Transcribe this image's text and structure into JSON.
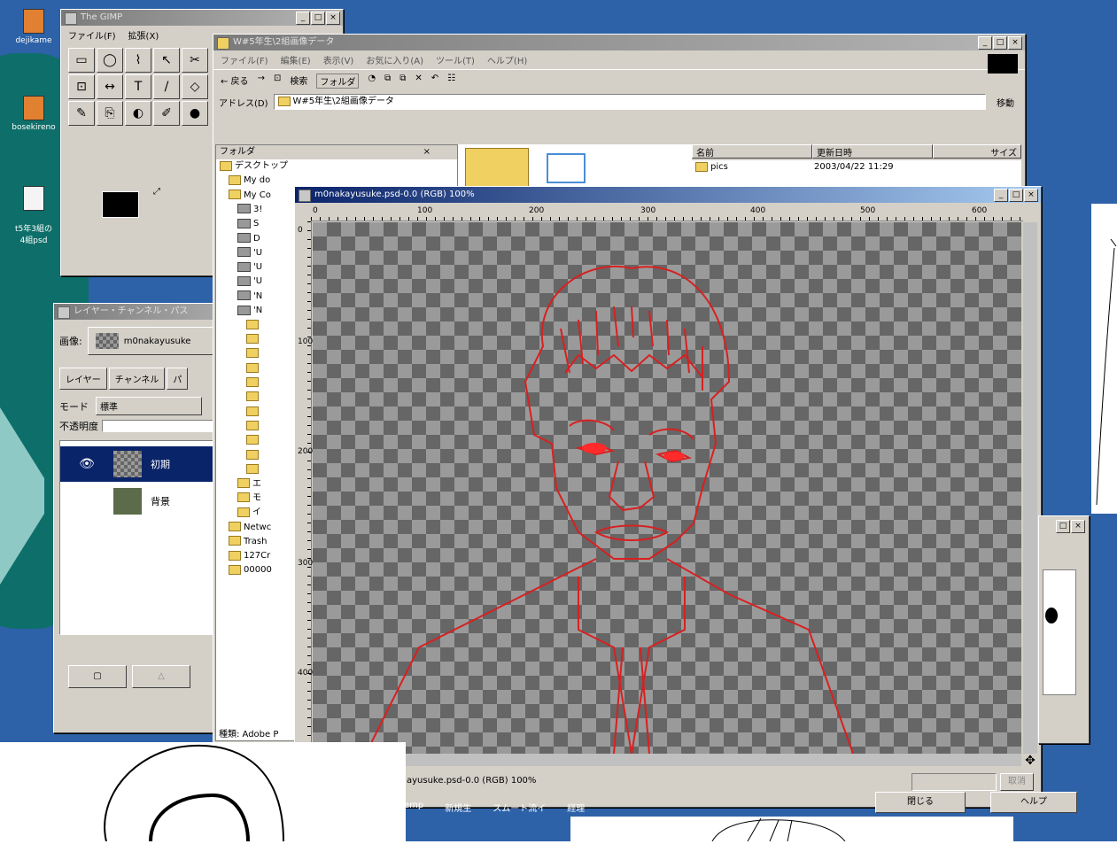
{
  "desktop": {
    "icons": [
      {
        "label": "dejikame"
      },
      {
        "label": "bosekireno"
      },
      {
        "label": "t5年3組の\n4組psd"
      }
    ]
  },
  "toolbox": {
    "title": "The GIMP",
    "menu": [
      "ファイル(F)",
      "拡張(X)"
    ],
    "tools": [
      "▭",
      "◯",
      "⌇",
      "↖",
      "✂",
      "⊡",
      "↔",
      "T",
      "/",
      "◇",
      "✎",
      "⎘",
      "◐",
      "✐",
      "●"
    ]
  },
  "layers": {
    "title": "レイヤー・チャンネル・パス",
    "image_label": "画像:",
    "image_name": "m0nakayusuke",
    "tabs": [
      "レイヤー",
      "チャンネル",
      "パ"
    ],
    "mode_label": "モード",
    "mode_value": "標準",
    "opacity_label": "不透明度",
    "rows": [
      {
        "name": "初期"
      },
      {
        "name": "背景"
      }
    ]
  },
  "explorer": {
    "title": "W#5年生\\2組画像データ",
    "menu": [
      "ファイル(F)",
      "編集(E)",
      "表示(V)",
      "お気に入り(A)",
      "ツール(T)",
      "ヘルプ(H)"
    ],
    "toolbar": [
      "← 戻る",
      "→",
      "⊡",
      "検索",
      "フォルダ",
      "◔",
      "⧉",
      "⧉",
      "✕",
      "↶",
      "☷"
    ],
    "address_label": "アドレス(D)",
    "address_value": "W#5年生\\2組画像データ",
    "go_label": "移動",
    "folders_header": "フォルダ",
    "tree": [
      "デスクトップ",
      "My do",
      "My Co",
      "3!",
      "S",
      "D",
      "'U",
      "'U",
      "'U",
      "'N",
      "'N",
      "",
      "",
      "",
      "",
      "",
      "",
      "",
      "",
      "",
      "",
      "",
      "エ",
      "モ",
      "イ",
      "Netwc",
      "Trash",
      "127Cr",
      "00000"
    ],
    "columns": [
      "名前",
      "更新日時",
      "サイズ"
    ],
    "files": [
      {
        "name": "pics",
        "date": "2003/04/22 11:29"
      }
    ],
    "status_text": "種類: Adobe P"
  },
  "canvas": {
    "title": "m0nakayusuke.psd-0.0 (RGB) 100%",
    "ruler_h": [
      "0",
      "100",
      "200",
      "300",
      "400",
      "500",
      "600"
    ],
    "ruler_v": [
      "0",
      "100",
      "200",
      "300",
      "400"
    ],
    "status": "ayusuke.psd-0.0 (RGB) 100%",
    "status_btn": "取消"
  },
  "dialog": {
    "buttons": [
      "閉じる",
      "ヘルプ"
    ]
  },
  "taskbar": {
    "items": [
      "emp",
      "新規生",
      "スムート流イ",
      "経理"
    ]
  },
  "colors": {
    "desktop": "#2d62a8",
    "outline": "#d82020"
  }
}
